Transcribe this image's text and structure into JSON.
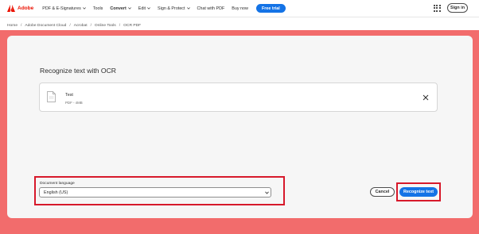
{
  "header": {
    "brand": "Adobe",
    "nav": [
      {
        "label": "PDF & E-Signatures",
        "dropdown": true
      },
      {
        "label": "Tools",
        "dropdown": false
      },
      {
        "label": "Convert",
        "dropdown": true,
        "active": true
      },
      {
        "label": "Edit",
        "dropdown": true
      },
      {
        "label": "Sign & Protect",
        "dropdown": true
      },
      {
        "label": "Chat with PDF",
        "dropdown": false
      },
      {
        "label": "Buy now",
        "dropdown": false
      }
    ],
    "trial_label": "Free trial",
    "signin_label": "Sign in",
    "apps_icon": "apps-grid-icon"
  },
  "breadcrumb": [
    "Home",
    "Adobe Document Cloud",
    "Acrobat",
    "Online Tools",
    "OCR PDF"
  ],
  "main": {
    "title": "Recognize text with OCR",
    "file": {
      "name": "Test",
      "meta": "PDF - 4MB"
    },
    "language": {
      "label": "Document language",
      "value": "English (US)"
    },
    "cancel_label": "Cancel",
    "recognize_label": "Recognize text"
  },
  "colors": {
    "brand_red": "#eb1000",
    "accent_blue": "#1473e6",
    "hero_salmon": "#f26c6c",
    "highlight_red": "#d7192b"
  }
}
